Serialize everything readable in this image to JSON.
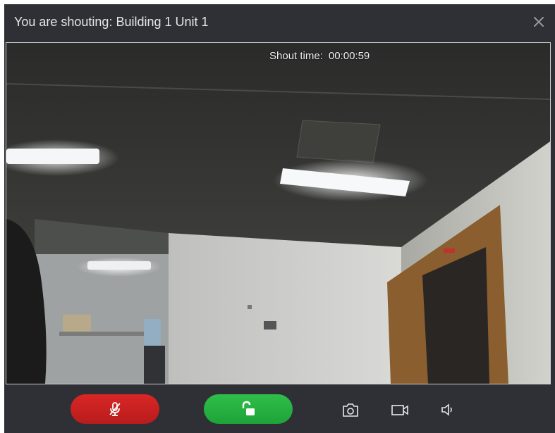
{
  "window": {
    "title": "You are shouting: Building 1 Unit 1",
    "close_icon": "close-icon"
  },
  "video": {
    "shout_time_label": "Shout time:",
    "shout_time_value": "00:00:59"
  },
  "controls": {
    "mic_button": {
      "icon": "mic-muted-icon",
      "color": "#d32424"
    },
    "unlock_button": {
      "icon": "unlock-icon",
      "color": "#27b443"
    },
    "snapshot_button": {
      "icon": "camera-icon"
    },
    "record_button": {
      "icon": "video-record-icon"
    },
    "volume_button": {
      "icon": "speaker-icon"
    }
  },
  "colors": {
    "dialog_bg": "#2e3036",
    "title_text": "#e6e6e6",
    "icon_color": "#e8e8e8"
  }
}
